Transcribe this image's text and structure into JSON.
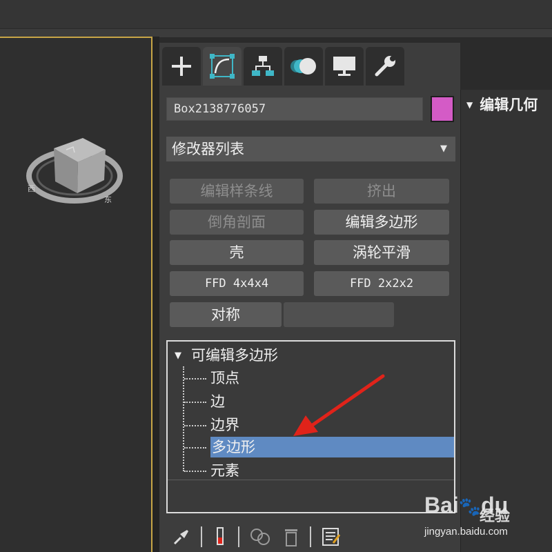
{
  "object_name": "Box2138776057",
  "object_color": "#d45bc6",
  "modifier_list": {
    "label": "修改器列表"
  },
  "modifier_buttons": [
    {
      "label": "编辑样条线",
      "enabled": false
    },
    {
      "label": "挤出",
      "enabled": false
    },
    {
      "label": "倒角剖面",
      "enabled": false
    },
    {
      "label": "编辑多边形",
      "enabled": true
    },
    {
      "label": "壳",
      "enabled": true
    },
    {
      "label": "涡轮平滑",
      "enabled": true
    },
    {
      "label": "FFD 4x4x4",
      "enabled": true
    },
    {
      "label": "FFD 2x2x2",
      "enabled": true
    },
    {
      "label": "对称",
      "enabled": true
    }
  ],
  "stack": {
    "title": "可编辑多边形",
    "items": [
      "顶点",
      "边",
      "边界",
      "多边形",
      "元素"
    ],
    "selected": "多边形"
  },
  "rollout": {
    "title": "编辑几何"
  },
  "tabs": [
    "create-tab",
    "modify-tab",
    "hierarchy-tab",
    "motion-tab",
    "display-tab",
    "utilities-tab"
  ],
  "watermark": {
    "text": "经验",
    "url": "jingyan.baidu.com"
  },
  "colors": {
    "selection": "#5f8ac2",
    "viewport_border": "#c8a646",
    "arrow": "#e0231a",
    "icon_cyan": "#3fb7c7"
  }
}
